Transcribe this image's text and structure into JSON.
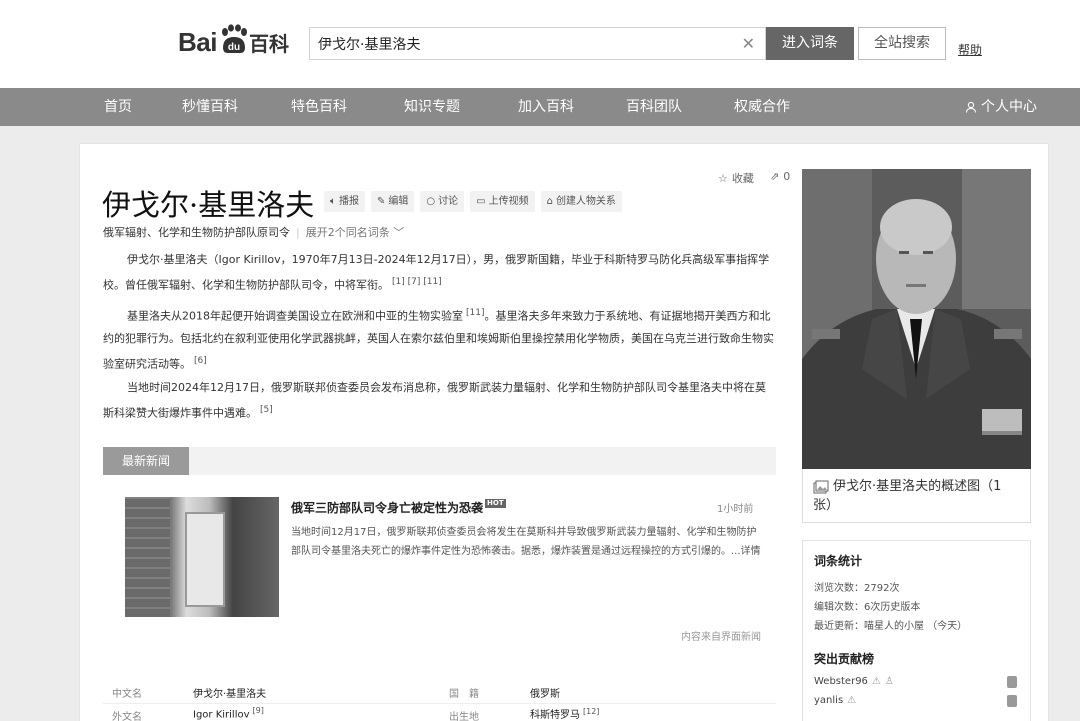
{
  "header": {
    "logo_bai": "Bai",
    "logo_baike": "百科",
    "search_value": "伊戈尔·基里洛夫",
    "enter_label": "进入词条",
    "site_search_label": "全站搜索",
    "help_label": "帮助"
  },
  "nav": {
    "items": [
      "首页",
      "秒懂百科",
      "特色百科",
      "知识专题",
      "加入百科",
      "百科团队",
      "权威合作"
    ],
    "user_label": "个人中心"
  },
  "entry": {
    "fav_label": "收藏",
    "share_count": "0",
    "title": "伊戈尔·基里洛夫",
    "tools": [
      "播报",
      "编辑",
      "讨论",
      "上传视频",
      "创建人物关系"
    ],
    "subtitle": "俄军辐射、化学和生物防护部队原司令",
    "expand_label": "展开2个同名词条",
    "para1": "伊戈尔·基里洛夫（Igor Kirillov，1970年7月13日-2024年12月17日），男，俄罗斯国籍，毕业于科斯特罗马防化兵高级军事指挥学校。曾任俄军辐射、化学和生物防护部队司令，中将军衔。",
    "para1_refs": "[1] [7] [11]",
    "para2": "基里洛夫从2018年起便开始调查美国设立在欧洲和中亚的生物实验室",
    "para2_ref1": "[11]",
    "para2b": "。基里洛夫多年来致力于系统地、有证据地揭开美西方和北约的犯罪行为。包括北约在叙利亚使用化学武器挑衅，英国人在索尔兹伯里和埃姆斯伯里操控禁用化学物质，美国在乌克兰进行致命生物实验室研究活动等。",
    "para2_ref2": "[6]",
    "para3": "当地时间2024年12月17日，俄罗斯联邦侦查委员会发布消息称，俄罗斯武装力量辐射、化学和生物防护部队司令基里洛夫中将在莫斯科梁赞大街爆炸事件中遇难。",
    "para3_ref": "[5]"
  },
  "news": {
    "tab_label": "最新新闻",
    "title": "俄军三防部队司令身亡被定性为恐袭",
    "hot": "HOT",
    "time": "1小时前",
    "body": "当地时间12月17日，俄罗斯联邦侦查委员会将发生在莫斯科并导致俄罗斯武装力量辐射、化学和生物防护部队司令基里洛夫死亡的爆炸事件定性为恐怖袭击。据悉，爆炸装置是通过远程操控的方式引爆的。",
    "more": "...详情",
    "source": "内容来自界面新闻"
  },
  "info": {
    "rows": [
      {
        "label1": "中文名",
        "value1": "伊戈尔·基里洛夫",
        "ref1": "",
        "label2": "国　籍",
        "value2": "俄罗斯",
        "ref2": ""
      },
      {
        "label1": "外文名",
        "value1": "Igor Kirillov",
        "ref1": "[9]",
        "label2": "出生地",
        "value2": "科斯特罗马",
        "ref2": "[12]"
      }
    ]
  },
  "sidebar": {
    "caption": "伊戈尔·基里洛夫的概述图（1张）",
    "stats_title": "词条统计",
    "views": "浏览次数：2792次",
    "edits": "编辑次数：6次历史版本",
    "updated": "最近更新：喵星人的小屋 （今天）",
    "contrib_title": "突出贡献榜",
    "contributors": [
      "Webster96",
      "yanlis"
    ]
  },
  "colors": {
    "nav_bg": "#8a8a8a",
    "primary_button": "#666666",
    "page_bg": "#ececec"
  }
}
